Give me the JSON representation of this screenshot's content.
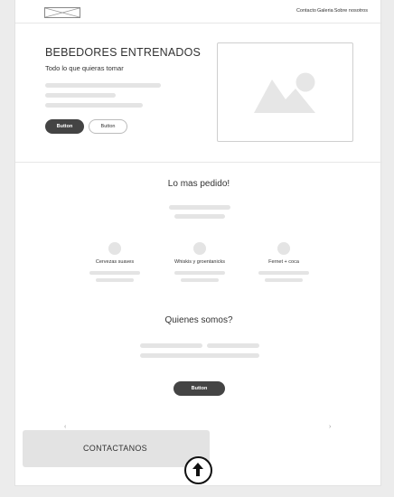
{
  "nav": {
    "links": [
      "Contacto",
      "Galeria",
      "Sobre nosotros"
    ]
  },
  "hero": {
    "title": "BEBEDORES ENTRENADOS",
    "subtitle": "Todo lo que quieras tomar",
    "primary_button": "Button",
    "secondary_button": "Button",
    "image_icon": "image-placeholder-icon"
  },
  "popular": {
    "title": "Lo mas pedido!",
    "items": [
      {
        "label": "Cervezas suaves"
      },
      {
        "label": "Whiskis y groentanicks"
      },
      {
        "label": "Fernet + coca"
      }
    ]
  },
  "about": {
    "title": "Quienes somos?",
    "button": "Button"
  },
  "carousel": {
    "prev_icon": "chevron-left-icon",
    "next_icon": "chevron-right-icon"
  },
  "contact": {
    "label": "CONTACTANOS"
  },
  "scroll_top_icon": "arrow-up-circle-icon",
  "colors": {
    "dark_button": "#444444",
    "placeholder": "#e4e4e4",
    "background": "#ececec"
  }
}
